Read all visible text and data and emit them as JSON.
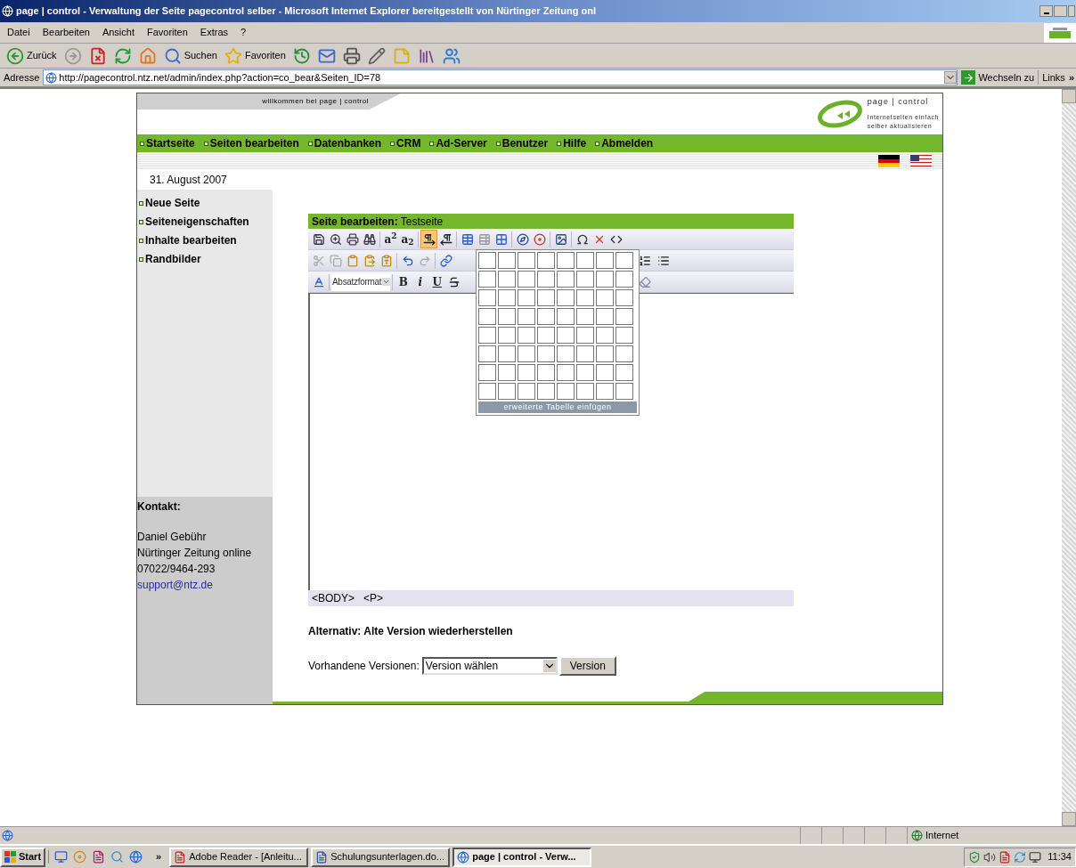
{
  "browser": {
    "title": "page | control - Verwaltung der Seite pagecontrol selber - Microsoft Internet Explorer bereitgestellt von Nürtinger Zeitung onl",
    "menu": [
      "Datei",
      "Bearbeiten",
      "Ansicht",
      "Favoriten",
      "Extras",
      "?"
    ],
    "toolbar": [
      {
        "kind": "back",
        "label": "Zurück"
      },
      {
        "kind": "forward"
      },
      {
        "kind": "stop"
      },
      {
        "kind": "refresh"
      },
      {
        "kind": "home"
      },
      {
        "kind": "search",
        "label": "Suchen"
      },
      {
        "kind": "favorites",
        "label": "Favoriten"
      },
      {
        "kind": "history"
      },
      {
        "kind": "mail"
      },
      {
        "kind": "print"
      },
      {
        "kind": "edit"
      },
      {
        "kind": "note"
      },
      {
        "kind": "research"
      },
      {
        "kind": "messenger"
      }
    ],
    "address_label": "Adresse",
    "url": "http://pagecontrol.ntz.net/admin/index.php?action=co_bear&Seiten_ID=78",
    "go": "Wechseln zu",
    "links": "Links",
    "links_more": "»"
  },
  "page": {
    "welcome": "willkommen bei page | control",
    "logo_name": "page | control",
    "logo_tagline": [
      "Internetseiten einfach",
      "selber aktualisieren"
    ],
    "nav": [
      "Startseite",
      "Seiten bearbeiten",
      "Datenbanken",
      "CRM",
      "Ad-Server",
      "Benutzer",
      "Hilfe",
      "Abmelden"
    ],
    "date": "31. August 2007",
    "sidebar": [
      "Neue Seite",
      "Seiteneigenschaften",
      "Inhalte bearbeiten",
      "Randbilder"
    ],
    "contact_title": "Kontakt:",
    "contact_lines": [
      "Daniel Gebühr",
      "Nürtinger Zeitung online",
      "07022/9464-293"
    ],
    "contact_email": "support@ntz.de",
    "editor": {
      "title_bold": "Seite bearbeiten:",
      "title": "Testseite",
      "rows": [
        {
          "left": [
            {
              "kind": "save",
              "selected": false
            },
            {
              "kind": "preview",
              "selected": false
            },
            {
              "kind": "print",
              "selected": false
            },
            {
              "kind": "find",
              "selected": false
            },
            {
              "kind": "sep"
            },
            {
              "kind": "sup",
              "label": "a$^{2}$",
              "selected": false
            },
            {
              "kind": "sub",
              "label": "a$_{2}$",
              "selected": false
            },
            {
              "kind": "sep"
            },
            {
              "kind": "ltr",
              "selected": true
            },
            {
              "kind": "rtl",
              "selected": false
            },
            {
              "kind": "sep"
            },
            {
              "kind": "table",
              "selected": false
            },
            {
              "kind": "table-edit",
              "selected": false
            },
            {
              "kind": "cell",
              "selected": false
            },
            {
              "kind": "sep"
            },
            {
              "kind": "anchor",
              "selected": false
            },
            {
              "kind": "color",
              "selected": false
            },
            {
              "kind": "sep"
            },
            {
              "kind": "image",
              "selected": false
            },
            {
              "kind": "sep"
            },
            {
              "kind": "omega",
              "selected": false
            },
            {
              "kind": "remove",
              "selected": false
            },
            {
              "kind": "code",
              "selected": false
            }
          ],
          "right": []
        },
        {
          "left": [
            {
              "kind": "cut",
              "selected": false
            },
            {
              "kind": "copy",
              "selected": false
            },
            {
              "kind": "paste",
              "selected": false
            },
            {
              "kind": "paste-word",
              "selected": false
            },
            {
              "kind": "paste-text",
              "selected": false
            },
            {
              "kind": "sep"
            },
            {
              "kind": "undo",
              "selected": false
            },
            {
              "kind": "redo",
              "selected": false
            },
            {
              "kind": "sep"
            },
            {
              "kind": "link",
              "selected": false
            }
          ],
          "right": [
            {
              "kind": "ol",
              "selected": false
            },
            {
              "kind": "ul",
              "selected": false
            }
          ]
        },
        {
          "left": [
            {
              "kind": "font-color",
              "selected": false
            },
            {
              "kind": "sep"
            },
            {
              "kind": "format",
              "label": "Absatzformat"
            },
            {
              "kind": "sep"
            },
            {
              "kind": "bold",
              "label": "B",
              "selected": false
            },
            {
              "kind": "italic",
              "label": "i",
              "selected": false
            },
            {
              "kind": "underline",
              "label": "U",
              "selected": false
            },
            {
              "kind": "strike",
              "selected": false
            }
          ],
          "right": [
            {
              "kind": "eraser",
              "selected": false
            }
          ]
        }
      ],
      "table_picker_footer": "erweiterte Tabelle einfügen",
      "path": [
        "<BODY>",
        "<P>"
      ]
    },
    "restore_title": "Alternativ: Alte Version wiederherstellen",
    "versions_label": "Vorhandene Versionen:",
    "versions_value": "Version wählen",
    "version_button": "Version"
  },
  "status_bar": {
    "zone": "Internet"
  },
  "taskbar": {
    "start": "Start",
    "more": "»",
    "tasks": [
      {
        "kind": "pdf",
        "label": "Adobe Reader - [Anleitu...",
        "selected": false
      },
      {
        "kind": "word",
        "label": "Schulungsunterlagen.do...",
        "selected": false
      },
      {
        "kind": "browser",
        "label": "page | control - Verw...",
        "selected": true
      }
    ],
    "clock": "11:34"
  }
}
